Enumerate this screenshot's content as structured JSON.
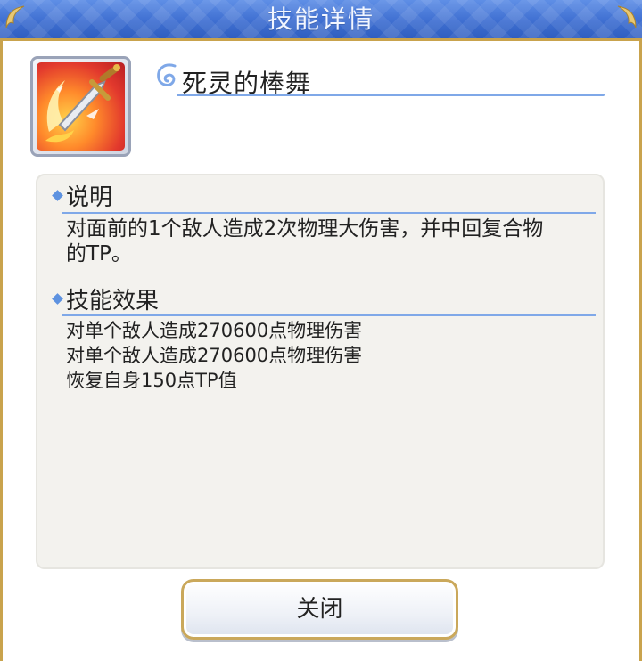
{
  "header": {
    "title": "技能详情"
  },
  "skill": {
    "icon": "sword-fire-icon",
    "name": "死灵的棒舞"
  },
  "description": {
    "title": "说明",
    "text": "对面前的1个敌人造成2次物理大伤害，并中回复合物的TP。"
  },
  "effects": {
    "title": "技能效果",
    "lines": [
      "对单个敌人造成270600点物理伤害",
      "对单个敌人造成270600点物理伤害",
      "恢复自身150点TP值"
    ]
  },
  "close_button": {
    "label": "关闭"
  },
  "colors": {
    "header_blue": "#3f6fd1",
    "gold_border": "#c9a34d",
    "accent_line": "#7fa8e8",
    "panel_bg": "#f3f2ee"
  }
}
